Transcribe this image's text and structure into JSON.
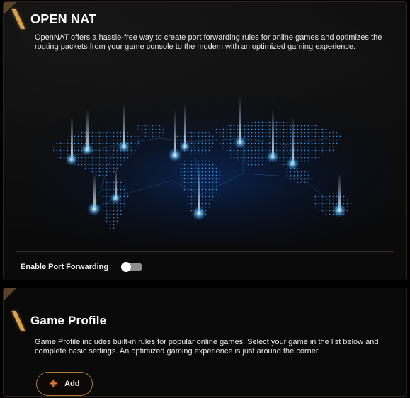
{
  "open_nat": {
    "title": "OPEN NAT",
    "description": "OpenNAT offers a hassle-free way to create port forwarding rules for online games and optimizes the routing packets from your game console to the modem with an optimized gaming experience.",
    "image": "world-network-map",
    "port_forwarding": {
      "label": "Enable Port Forwarding",
      "enabled": false
    }
  },
  "game_profile": {
    "title": "Game Profile",
    "description": "Game Profile includes built-in rules for popular online games. Select your game in the list below and complete basic settings. An optimized gaming experience is just around the corner.",
    "add_label": "Add",
    "add_icon": "plus-icon"
  },
  "colors": {
    "accent": "#d9a24a",
    "plus": "#e07a3a",
    "map_glow": "#4ab8ff"
  }
}
